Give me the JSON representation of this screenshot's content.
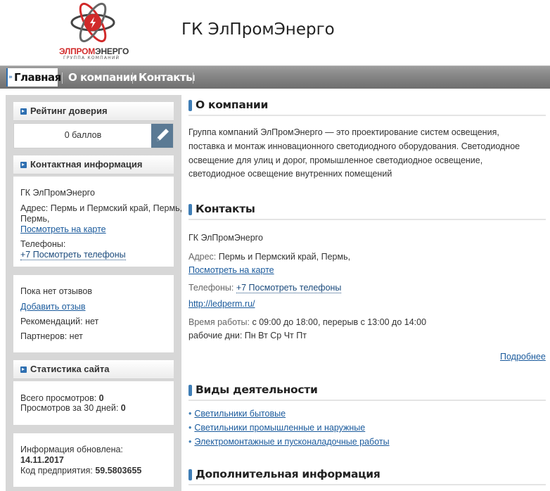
{
  "header": {
    "logo_word_a": "ЭЛПРОМ",
    "logo_word_b": "ЭНЕРГО",
    "logo_sub": "ГРУППА КОМПАНИЙ",
    "title": "ГК ЭлПромЭнерго"
  },
  "nav": {
    "items": [
      {
        "label": "Главная"
      },
      {
        "label": "О компании"
      },
      {
        "label": "Контакты"
      }
    ]
  },
  "sidebar": {
    "rating": {
      "heading": "Рейтинг доверия",
      "value": "0 баллов"
    },
    "contact": {
      "heading": "Контактная информация",
      "company": "ГК ЭлПромЭнерго",
      "address_line1": "Адрес: Пермь и Пермский край, Пермь,",
      "address_line2": "Пермь,",
      "map_link": "Посмотреть на карте",
      "phones_label": "Телефоны:",
      "phones_link": "+7 Посмотреть телефоны"
    },
    "reviews": {
      "none": "Пока нет отзывов",
      "add_link": "Добавить отзыв",
      "recommendations": "Рекомендаций: нет",
      "partners": "Партнеров: нет"
    },
    "stats": {
      "heading": "Статистика сайта",
      "total_label": "Всего просмотров:",
      "total_value": "0",
      "month_label": "Просмотров за 30 дней:",
      "month_value": "0"
    },
    "info": {
      "updated_label": "Информация обновлена:",
      "updated_value": "14.11.2017",
      "code_label": "Код предприятия:",
      "code_value": "59.5803655"
    }
  },
  "main": {
    "about": {
      "heading": "О компании",
      "lines": [
        "Группа компаний ЭлПромЭнерго — это проектирование систем освещения,",
        "поставка и монтаж инновационного светодиодного оборудования. Светодиодное",
        "освещение для улиц и дорог, промышленное светодиодное освещение,",
        "светодиодное освещение внутренних помещений"
      ]
    },
    "contacts": {
      "heading": "Контакты",
      "company": "ГК ЭлПромЭнерго",
      "address_label": "Адрес:",
      "address_value": "Пермь и Пермский край, Пермь,",
      "map_link": "Посмотреть на карте",
      "phones_label": "Телефоны:",
      "phones_link": "+7 Посмотреть телефоны",
      "website": "http://ledperm.ru/",
      "hours_label": "Время работы:",
      "hours_value": "с 09:00 до 18:00, перерыв с 13:00 до 14:00",
      "days": "рабочие дни: Пн Вт Ср Чт Пт",
      "more_link": "Подробнее"
    },
    "activities": {
      "heading": "Виды деятельности",
      "items": [
        "Светильники бытовые",
        "Светильники промышленные и наружные",
        "Электромонтажные и пусконаладочные работы"
      ]
    },
    "extra": {
      "heading": "Дополнительная информация"
    }
  }
}
